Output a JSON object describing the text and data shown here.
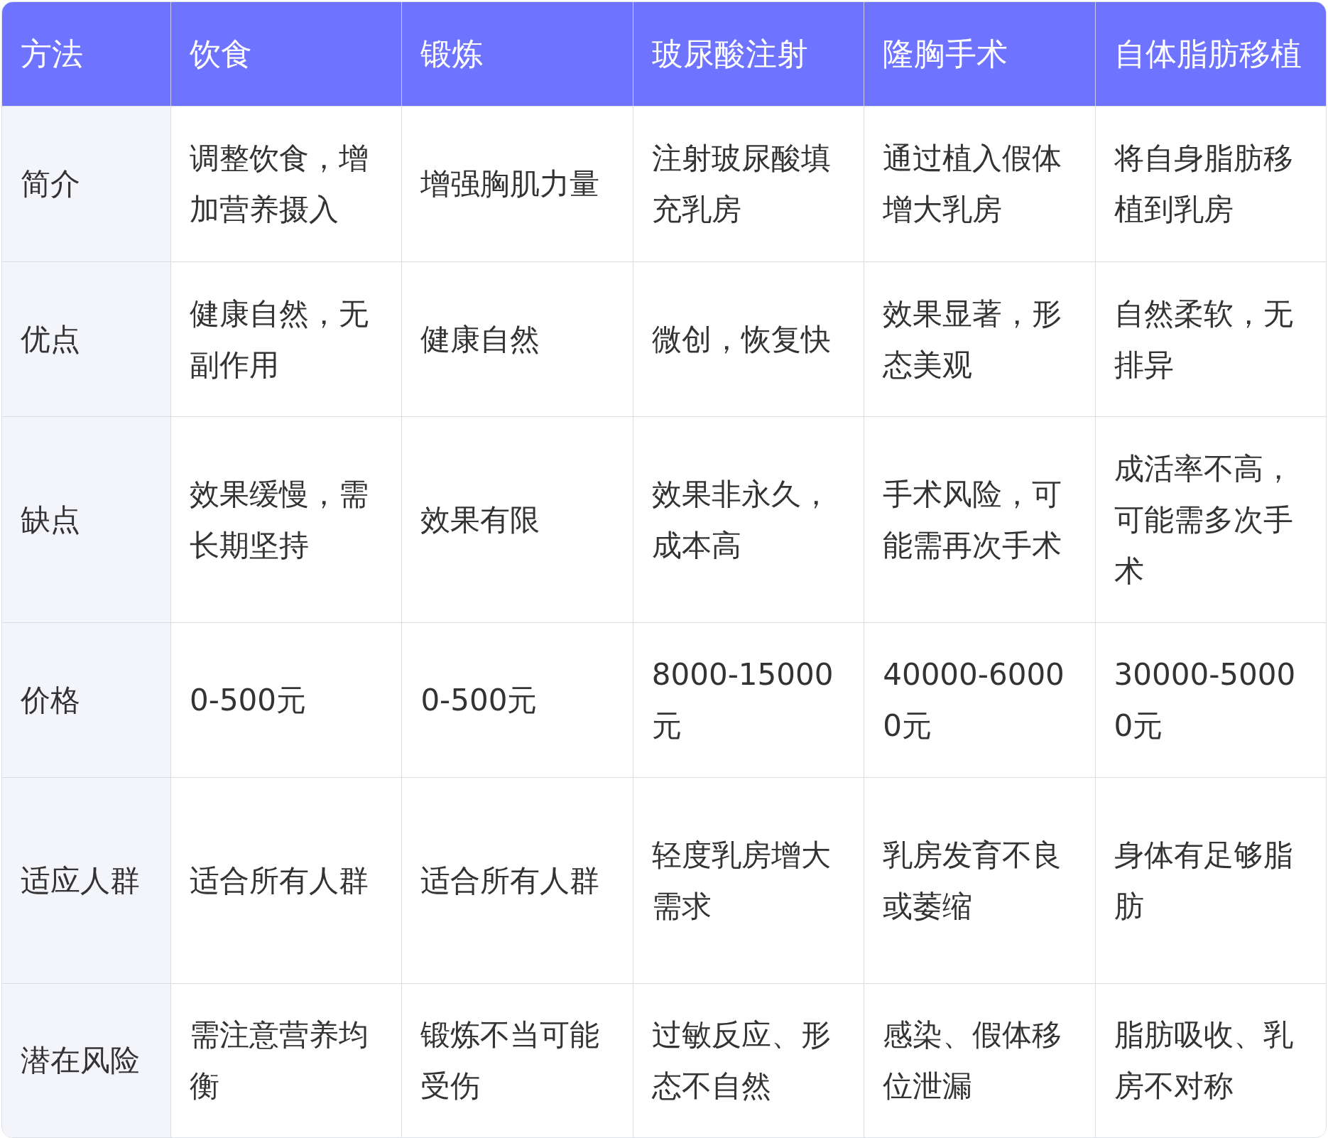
{
  "table": {
    "columns": [
      "方法",
      "饮食",
      "锻炼",
      "玻尿酸注射",
      "隆胸手术",
      "自体脂肪移植"
    ],
    "rows": [
      [
        "简介",
        "调整饮食，增加营养摄入",
        "增强胸肌力量",
        "注射玻尿酸填充乳房",
        "通过植入假体增大乳房",
        "将自身脂肪移植到乳房"
      ],
      [
        "优点",
        "健康自然，无副作用",
        "健康自然",
        "微创，恢复快",
        "效果显著，形态美观",
        "自然柔软，无排异"
      ],
      [
        "缺点",
        "效果缓慢，需长期坚持",
        "效果有限",
        "效果非永久，成本高",
        "手术风险，可能需再次手术",
        "成活率不高，可能需多次手术"
      ],
      [
        "价格",
        "0-500元",
        "0-500元",
        "8000-15000元",
        "40000-60000元",
        "30000-50000元"
      ],
      [
        "适应人群",
        "适合所有人群",
        "适合所有人群",
        "轻度乳房增大需求",
        "乳房发育不良或萎缩",
        "身体有足够脂肪"
      ],
      [
        "潜在风险",
        "需注意营养均衡",
        "锻炼不当可能受伤",
        "过敏反应、形态不自然",
        "感染、假体移位泄漏",
        "脂肪吸收、乳房不对称"
      ]
    ]
  }
}
